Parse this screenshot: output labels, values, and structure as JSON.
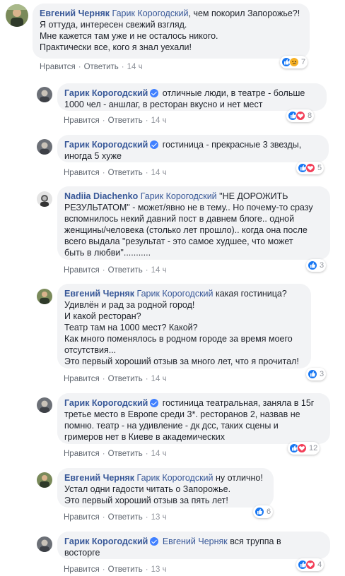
{
  "actions": {
    "like": "Нравится",
    "reply": "Ответить"
  },
  "comments": [
    {
      "author": "Евгений Черняк",
      "mention": "Гарик Корогодский",
      "lines": [
        ", чем покорил Запорожье?!",
        "Я оттуда, интересен свежий взгляд.",
        "Мне кажется там уже и не осталось никого.",
        "Практически все, кого я знал уехали!"
      ],
      "time": "14 ч",
      "reactions": {
        "types": [
          "like",
          "sad"
        ],
        "count": "7"
      }
    },
    {
      "author": "Гарик Корогодский",
      "verified": true,
      "lines": [
        " отличные люди, в театре - больше",
        "1000 чел - аншлаг, в ресторан вкусно и нет мест"
      ],
      "time": "14 ч",
      "reactions": {
        "types": [
          "like",
          "love"
        ],
        "count": "8"
      }
    },
    {
      "author": "Гарик Корогодский",
      "verified": true,
      "lines": [
        " гостиница - прекрасные 3 звезды,",
        "иногда 5 хуже"
      ],
      "time": "14 ч",
      "reactions": {
        "types": [
          "like",
          "love"
        ],
        "count": "5"
      }
    },
    {
      "author": "Nadiia Diachenko",
      "mention": "Гарик Корогодский",
      "lines": [
        " \"НЕ ДОРОЖИТЬ",
        "РЕЗУЛЬТАТОМ\" - может/явно не в тему.. Но почему-то сразу",
        "вспомнилось некий давний пост в давнем блоге.. одной",
        "женщины/человека (столько лет прошло).. когда она после",
        "всего выдала \"результат - это самое худшее, что может",
        "быть в любви\"..........."
      ],
      "time": "14 ч",
      "reactions": {
        "types": [
          "like"
        ],
        "count": "3"
      }
    },
    {
      "author": "Евгений Черняк",
      "mention": "Гарик Корогодский",
      "lines": [
        " какая гостиница?",
        "Удивлён и рад за родной город!",
        "И какой ресторан?",
        "Театр там на 1000 мест? Какой?",
        "Как много поменялось в родном городе за время моего",
        "отсутствия...",
        "Это первый хороший отзыв за много лет, что я прочитал!"
      ],
      "time": "14 ч",
      "reactions": {
        "types": [
          "like"
        ],
        "count": "3"
      }
    },
    {
      "author": "Гарик Корогодский",
      "verified": true,
      "lines": [
        " гостиница театральная, заняла в 15г",
        "третье место в Европе среди 3*. ресторанов 2, назвав не",
        "помню. театр - на удивление - дк дсс, таких сцены и",
        "гримеров нет в Киеве в академических"
      ],
      "time": "14 ч",
      "reactions": {
        "types": [
          "like",
          "love"
        ],
        "count": "12"
      }
    },
    {
      "author": "Евгений Черняк",
      "mention": "Гарик Корогодский",
      "lines": [
        " ну отлично!",
        "Устал одни гадости читать о Запорожье.",
        "Это первый хороший отзыв за пять лет!"
      ],
      "time": "13 ч",
      "reactions": {
        "types": [
          "like"
        ],
        "count": "6"
      }
    },
    {
      "author": "Гарик Корогодский",
      "verified": true,
      "mention": "Евгений Черняк",
      "lines": [
        " вся труппа в",
        "восторге"
      ],
      "time": "13 ч",
      "reactions": {
        "types": [
          "like",
          "love"
        ],
        "count": "4"
      }
    }
  ]
}
